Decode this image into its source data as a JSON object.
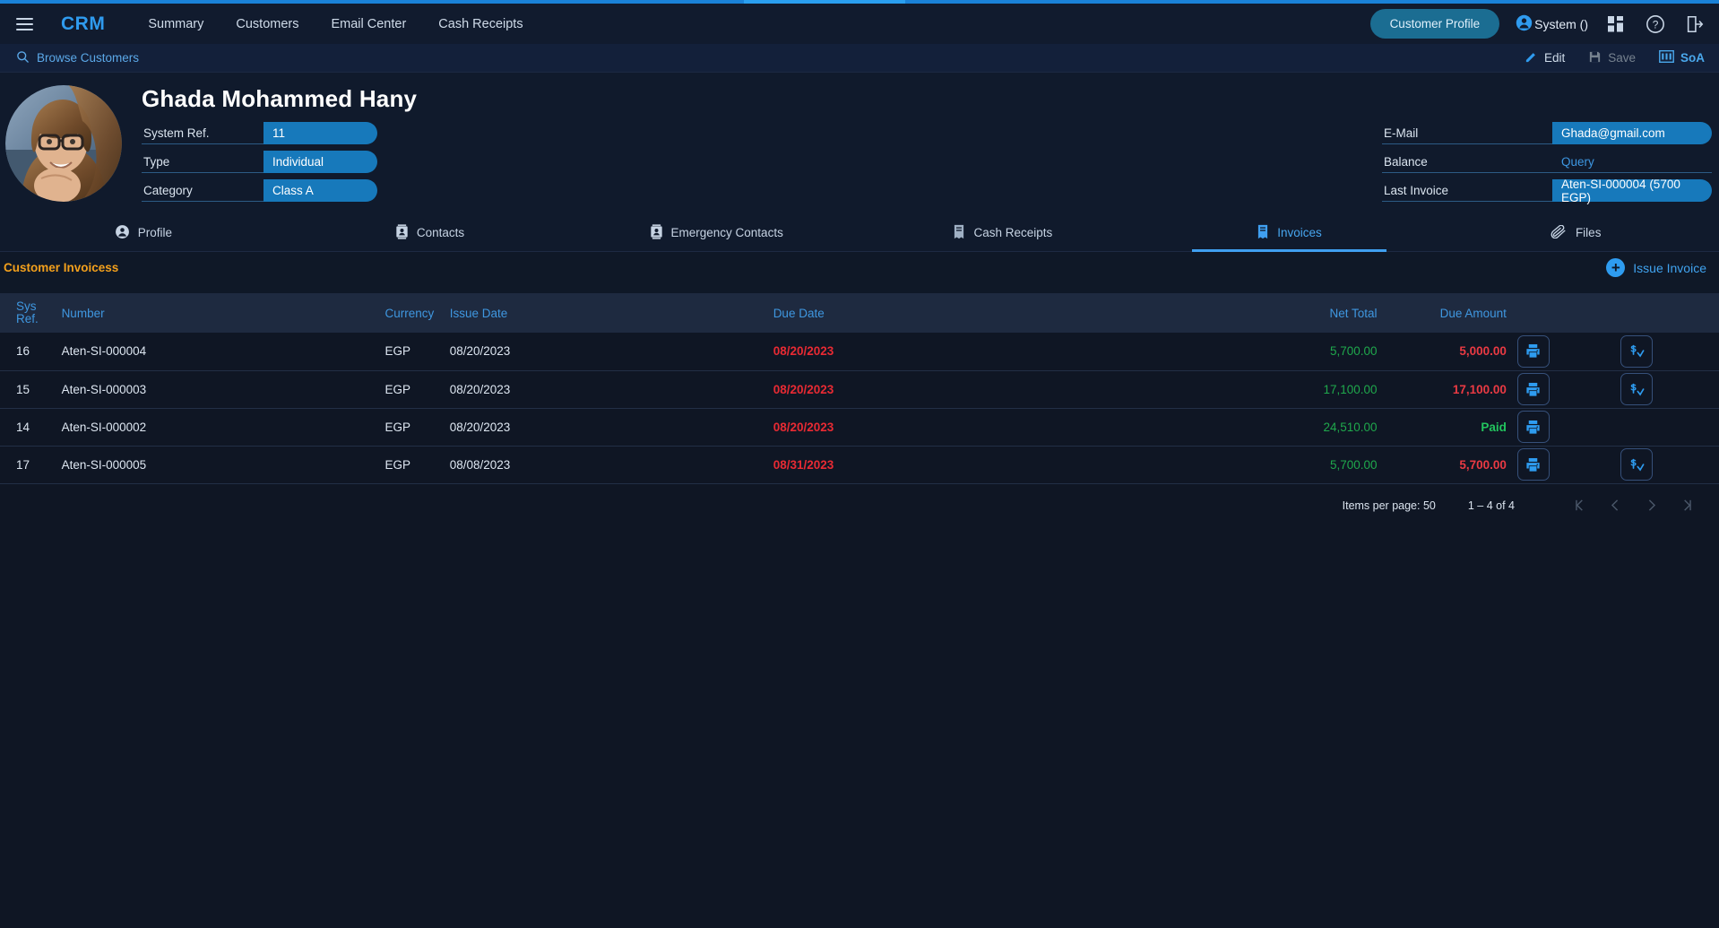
{
  "topnav": {
    "menu_icon": "hamburger-icon",
    "brand": "CRM",
    "links": [
      "Summary",
      "Customers",
      "Email Center",
      "Cash Receipts"
    ],
    "profile_pill": "Customer Profile",
    "user_label": "System ()",
    "icons": [
      "user-icon",
      "apps-grid-icon",
      "help-icon",
      "logout-icon"
    ]
  },
  "subbar": {
    "browse_label": "Browse Customers",
    "edit_label": "Edit",
    "save_label": "Save",
    "soa_label": "SoA"
  },
  "customer": {
    "name": "Ghada Mohammed Hany",
    "left_fields": [
      {
        "label": "System Ref.",
        "value": "11",
        "style": "pill"
      },
      {
        "label": "Type",
        "value": "Individual",
        "style": "pill"
      },
      {
        "label": "Category",
        "value": "Class A",
        "style": "pill"
      }
    ],
    "right_fields": [
      {
        "label": "E-Mail",
        "value": "Ghada@gmail.com",
        "style": "pill"
      },
      {
        "label": "Balance",
        "value": "Query",
        "style": "plain"
      },
      {
        "label": "Last Invoice",
        "value": "Aten-SI-000004 (5700 EGP)",
        "style": "pill"
      }
    ]
  },
  "tabs": [
    {
      "label": "Profile",
      "icon": "person-circle-icon",
      "active": false
    },
    {
      "label": "Contacts",
      "icon": "contact-card-icon",
      "active": false
    },
    {
      "label": "Emergency Contacts",
      "icon": "contact-card-icon",
      "active": false
    },
    {
      "label": "Cash Receipts",
      "icon": "receipt-icon",
      "active": false
    },
    {
      "label": "Invoices",
      "icon": "invoice-icon",
      "active": true
    },
    {
      "label": "Files",
      "icon": "attachment-icon",
      "active": false
    }
  ],
  "section": {
    "title": "Customer Invoicess",
    "issue_invoice_label": "Issue Invoice"
  },
  "table": {
    "columns": [
      "Sys Ref.",
      "Number",
      "Currency",
      "Issue Date",
      "Due Date",
      "Net Total",
      "Due Amount"
    ],
    "col_sysref_line1": "Sys",
    "col_sysref_line2": "Ref.",
    "rows": [
      {
        "sysref": "16",
        "number": "Aten-SI-000004",
        "currency": "EGP",
        "issue_date": "08/20/2023",
        "due_date": "08/20/2023",
        "net_total": "5,700.00",
        "due_amount": "5,000.00",
        "paid": false,
        "has_pay_action": true
      },
      {
        "sysref": "15",
        "number": "Aten-SI-000003",
        "currency": "EGP",
        "issue_date": "08/20/2023",
        "due_date": "08/20/2023",
        "net_total": "17,100.00",
        "due_amount": "17,100.00",
        "paid": false,
        "has_pay_action": true
      },
      {
        "sysref": "14",
        "number": "Aten-SI-000002",
        "currency": "EGP",
        "issue_date": "08/20/2023",
        "due_date": "08/20/2023",
        "net_total": "24,510.00",
        "due_amount": "Paid",
        "paid": true,
        "has_pay_action": false
      },
      {
        "sysref": "17",
        "number": "Aten-SI-000005",
        "currency": "EGP",
        "issue_date": "08/08/2023",
        "due_date": "08/31/2023",
        "net_total": "5,700.00",
        "due_amount": "5,700.00",
        "paid": false,
        "has_pay_action": true
      }
    ]
  },
  "paginator": {
    "items_per_page_label": "Items per page:",
    "items_per_page_value": "50",
    "range_label": "1 – 4 of 4"
  },
  "colors": {
    "accent_blue": "#2f9bef",
    "pill_blue": "#1779bb",
    "orange": "#f3a01c",
    "red": "#e82a33",
    "green": "#1fa84c",
    "paid_green": "#22c55e"
  }
}
